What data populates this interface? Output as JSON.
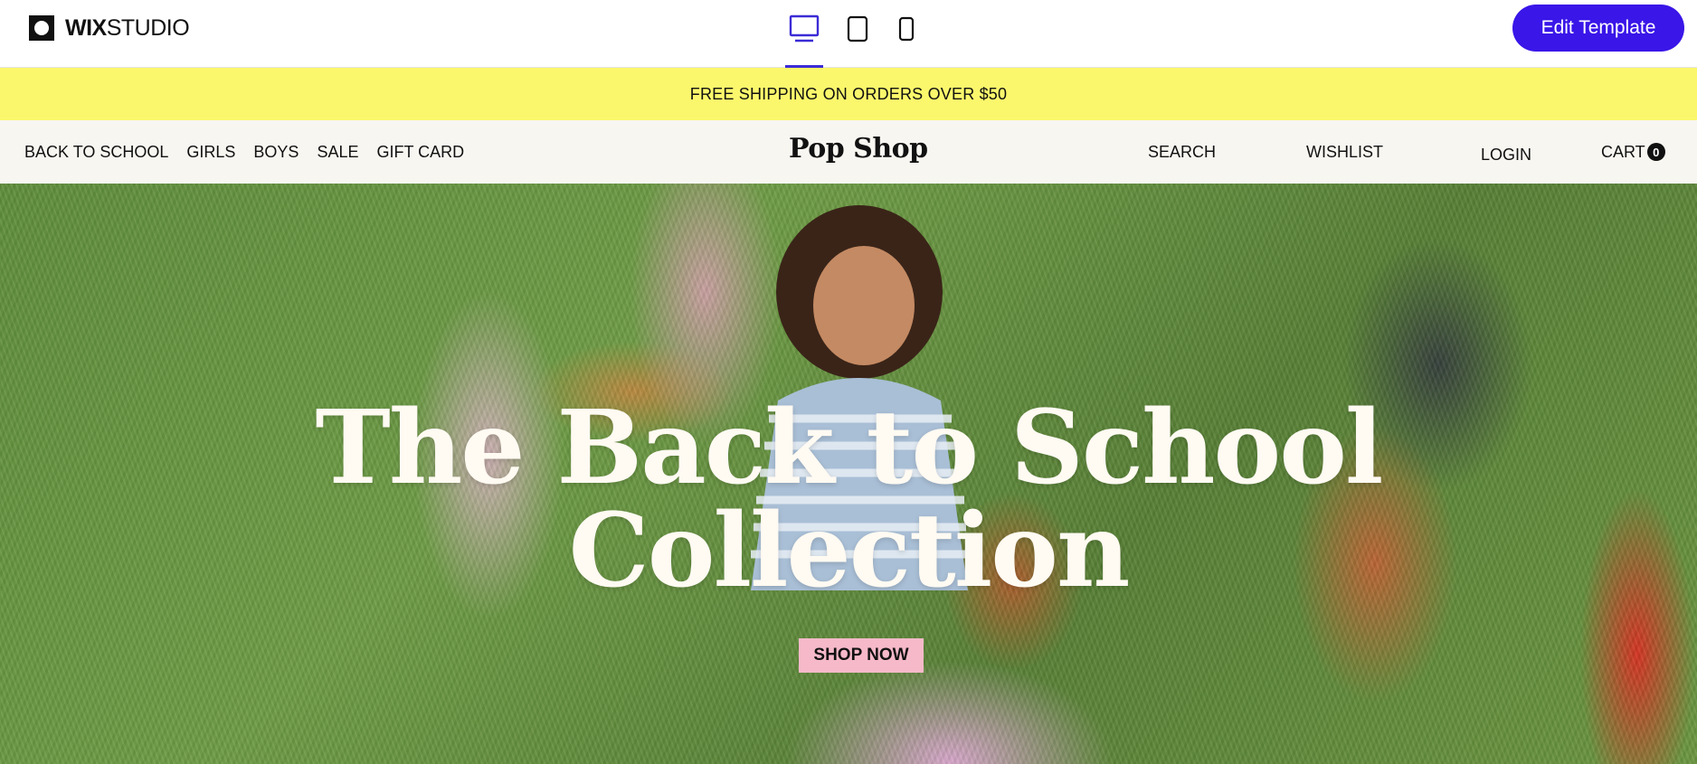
{
  "editor": {
    "logo_bold": "WIX",
    "logo_light": "STUDIO",
    "devices": [
      {
        "name": "desktop",
        "icon": "desktop-icon",
        "active": true
      },
      {
        "name": "tablet",
        "icon": "tablet-icon",
        "active": false
      },
      {
        "name": "mobile",
        "icon": "mobile-icon",
        "active": false
      }
    ],
    "edit_button_label": "Edit Template",
    "accent_color": "#3a16e8"
  },
  "promo": {
    "text": "FREE SHIPPING ON ORDERS OVER $50",
    "background": "#fbf76c"
  },
  "header": {
    "nav_left": [
      "BACK TO SCHOOL",
      "GIRLS",
      "BOYS",
      "SALE",
      "GIFT CARD"
    ],
    "brand": "Pop Shop",
    "search_label": "SEARCH",
    "wishlist_label": "WISHLIST",
    "login_label": "LOGIN",
    "cart_label": "CART",
    "cart_count": "0"
  },
  "hero": {
    "title_line1": "The Back to School",
    "title_line2": "Collection",
    "cta_label": "SHOP NOW",
    "cta_color": "#f6b9c9"
  }
}
